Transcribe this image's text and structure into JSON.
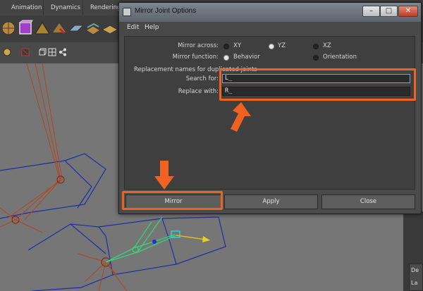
{
  "maya": {
    "menu_tabs": [
      "Animation",
      "Dynamics",
      "Rendering"
    ]
  },
  "right_panel": {
    "tabs": [
      "De",
      "La"
    ]
  },
  "dialog": {
    "title": "Mirror Joint Options",
    "window_buttons": {
      "minimize": "–",
      "maximize": "□",
      "close": "✕"
    },
    "menu": {
      "edit": "Edit",
      "help": "Help"
    },
    "mirror_across": {
      "label": "Mirror across:",
      "options": [
        "XY",
        "YZ",
        "XZ"
      ],
      "selected": "YZ"
    },
    "mirror_function": {
      "label": "Mirror function:",
      "options": [
        "Behavior",
        "Orientation"
      ],
      "selected": "Behavior"
    },
    "replacement": {
      "section_label": "Replacement names for duplicated joints",
      "search_label": "Search for:",
      "search_value": "L_",
      "replace_label": "Replace with:",
      "replace_value": "R_"
    },
    "buttons": {
      "mirror": "Mirror",
      "apply": "Apply",
      "close": "Close"
    }
  },
  "colors": {
    "highlight": "#f0621f",
    "field_focus": "#7fa1c4"
  },
  "icons": [
    "mirror-joint-window-icon",
    "orange-pointer-arrow",
    "maya-shelf-icon"
  ]
}
